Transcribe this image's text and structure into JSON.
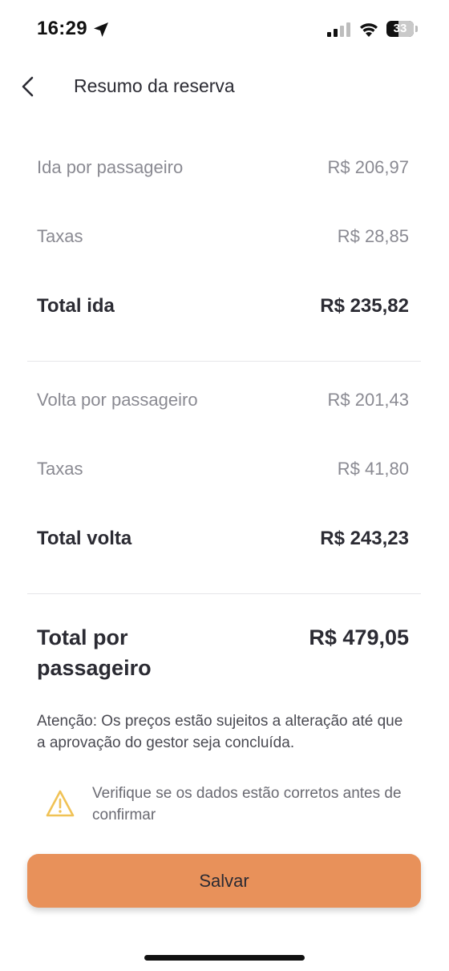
{
  "status_bar": {
    "time": "16:29",
    "battery": "33"
  },
  "header": {
    "title": "Resumo da reserva"
  },
  "outbound": {
    "per_passenger_label": "Ida por passageiro",
    "per_passenger_value": "R$ 206,97",
    "taxes_label": "Taxas",
    "taxes_value": "R$ 28,85",
    "total_label": "Total ida",
    "total_value": "R$ 235,82"
  },
  "return": {
    "per_passenger_label": "Volta por passageiro",
    "per_passenger_value": "R$ 201,43",
    "taxes_label": "Taxas",
    "taxes_value": "R$ 41,80",
    "total_label": "Total volta",
    "total_value": "R$ 243,23"
  },
  "grand_total": {
    "label": "Total por passageiro",
    "value": "R$ 479,05"
  },
  "notice": "Atenção: Os preços estão sujeitos a alteração até que a aprovação do gestor seja concluída.",
  "warning": "Verifique se os dados estão corretos antes de confirmar",
  "save_button": {
    "label": "Salvar",
    "color": "#e8915a"
  },
  "icons": {
    "back": "chevron-left-icon",
    "location": "location-arrow-icon",
    "signal": "cellular-signal-icon",
    "wifi": "wifi-icon",
    "battery": "battery-icon",
    "warning": "warning-triangle-icon"
  }
}
